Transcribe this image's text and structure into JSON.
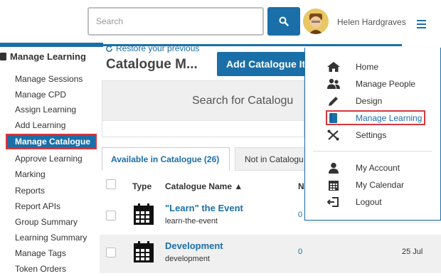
{
  "header": {
    "search_placeholder": "Search",
    "user_name": "Helen Hardgraves"
  },
  "sidebar": {
    "title": "Manage Learning",
    "items": [
      {
        "label": "Manage Sessions"
      },
      {
        "label": "Manage CPD"
      },
      {
        "label": "Assign Learning"
      },
      {
        "label": "Add Learning"
      },
      {
        "label": "Manage Catalogue",
        "active": true
      },
      {
        "label": "Approve Learning"
      },
      {
        "label": "Marking"
      },
      {
        "label": "Reports"
      },
      {
        "label": "Report APIs"
      },
      {
        "label": "Group Summary"
      },
      {
        "label": "Learning Summary"
      },
      {
        "label": "Manage Tags"
      },
      {
        "label": "Token Orders"
      }
    ]
  },
  "main": {
    "title": "Catalogue M...",
    "add_button": "Add Catalogue Ite",
    "search_panel_title": "Search for Catalogu",
    "restore_link": "Restore your previous",
    "tabs": [
      {
        "label": "Available in Catalogue (26)",
        "active": true
      },
      {
        "label": "Not in Catalogu",
        "active": false
      }
    ],
    "table": {
      "headers": [
        "Type",
        "Catalogue Name ▲",
        "N"
      ],
      "rows": [
        {
          "name": "\"Learn\" the Event",
          "slug": "learn-the-event",
          "count": "0",
          "date": ""
        },
        {
          "name": "Development",
          "slug": "development",
          "count": "0",
          "date": "25 Jul"
        }
      ]
    }
  },
  "menu": {
    "items": [
      {
        "label": "Home",
        "icon": "home-icon"
      },
      {
        "label": "Manage People",
        "icon": "people-icon"
      },
      {
        "label": "Design",
        "icon": "pencil-icon"
      },
      {
        "label": "Manage Learning",
        "icon": "book-icon",
        "highlighted": true
      },
      {
        "label": "Settings",
        "icon": "wrench-icon"
      },
      {
        "label": "My Account",
        "icon": "user-icon"
      },
      {
        "label": "My Calendar",
        "icon": "calendar-icon"
      },
      {
        "label": "Logout",
        "icon": "logout-icon"
      }
    ]
  },
  "colors": {
    "primary": "#1b6fa8",
    "highlight_border": "#d9363e"
  }
}
